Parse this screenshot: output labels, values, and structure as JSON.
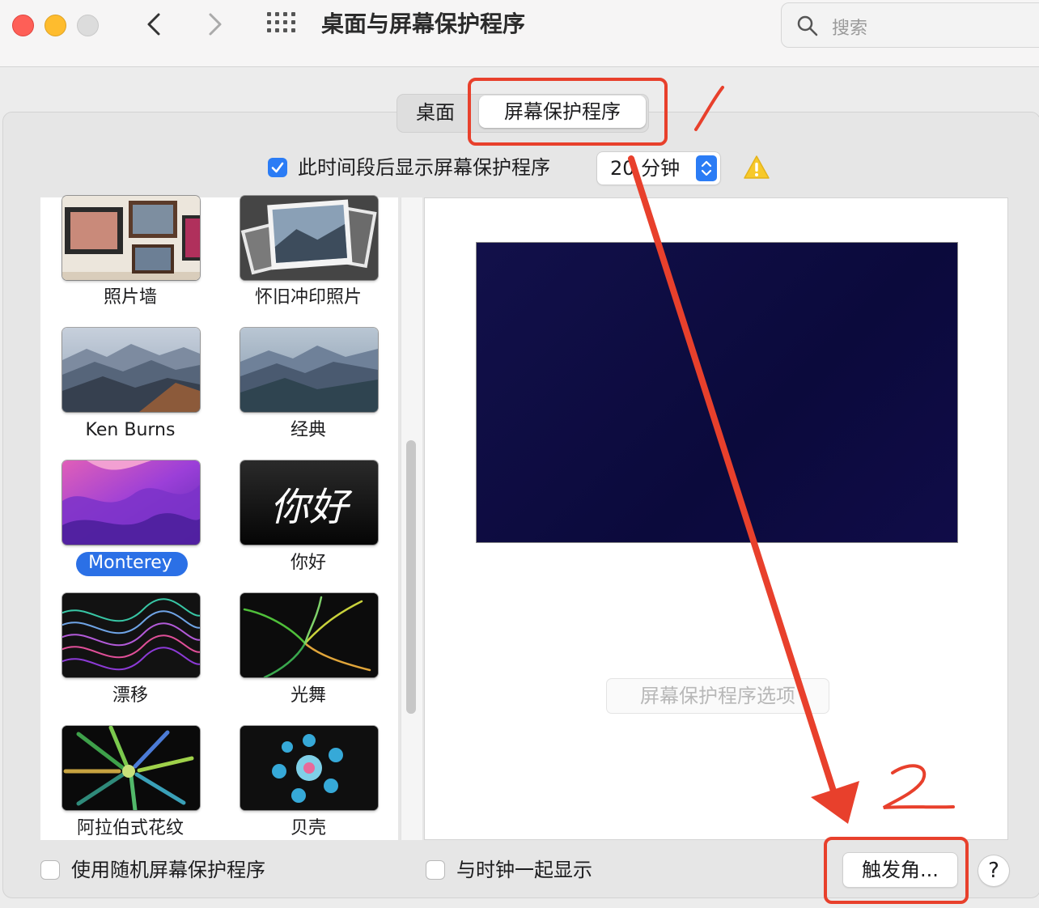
{
  "window": {
    "title": "桌面与屏幕保护程序"
  },
  "search": {
    "placeholder": "搜索"
  },
  "tabs": [
    {
      "label": "桌面"
    },
    {
      "label": "屏幕保护程序",
      "selected": true
    }
  ],
  "idle": {
    "checkbox_label": "此时间段后显示屏幕保护程序",
    "checked": true,
    "value": "20 分钟"
  },
  "savers": [
    {
      "label": "照片墙"
    },
    {
      "label": "怀旧冲印照片"
    },
    {
      "label": "Ken Burns"
    },
    {
      "label": "经典"
    },
    {
      "label": "Monterey",
      "selected": true
    },
    {
      "label": "你好",
      "thumb_text": "你好"
    },
    {
      "label": "漂移"
    },
    {
      "label": "光舞"
    },
    {
      "label": "阿拉伯式花纹"
    },
    {
      "label": "贝壳"
    }
  ],
  "preview": {
    "options_button": "屏幕保护程序选项"
  },
  "bottom": {
    "random_label": "使用随机屏幕保护程序",
    "random_checked": false,
    "clock_label": "与时钟一起显示",
    "clock_checked": false,
    "hot_corners": "触发角...",
    "help": "?"
  },
  "annotations": {
    "mark1": "1",
    "mark2": "2"
  },
  "colors": {
    "accent": "#2b7cf5",
    "annotation_red": "#e8402c",
    "preview_bg": "#0f0d45"
  }
}
